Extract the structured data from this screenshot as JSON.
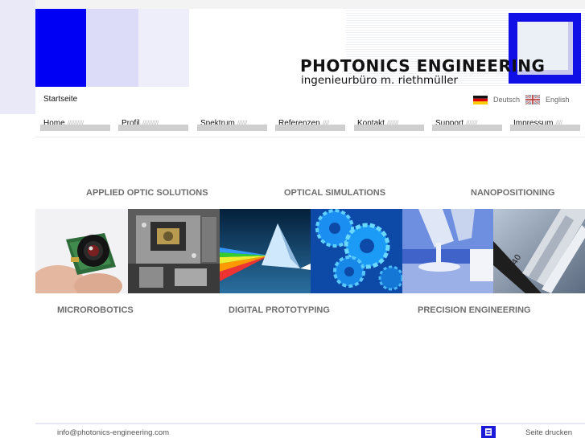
{
  "header": {
    "brand_title": "PHOTONICS ENGINEERING",
    "brand_subtitle": "ingenieurbüro m. riethmüller"
  },
  "breadcrumb": "Startseite",
  "languages": [
    {
      "label": "Deutsch",
      "flag": "de-flag-icon"
    },
    {
      "label": "English",
      "flag": "uk-flag-icon"
    }
  ],
  "nav": [
    {
      "label": "Home",
      "slashes": "//////////"
    },
    {
      "label": "Profil",
      "slashes": "//////////"
    },
    {
      "label": "Spektrum",
      "slashes": "//////"
    },
    {
      "label": "Referenzen",
      "slashes": "////"
    },
    {
      "label": "Kontakt",
      "slashes": "///////"
    },
    {
      "label": "Support",
      "slashes": "///////"
    },
    {
      "label": "Impressum",
      "slashes": "////"
    }
  ],
  "categories_top": [
    "APPLIED OPTIC SOLUTIONS",
    "OPTICAL SIMULATIONS",
    "NANOPOSITIONING"
  ],
  "categories_bottom": [
    "MICROROBOTICS",
    "DIGITAL PROTOTYPING",
    "PRECISION ENGINEERING"
  ],
  "colors": {
    "brand_blue": "#0000f5",
    "lavender": "#dcdcf8",
    "category_gray": "#6e6e6e"
  },
  "footer": {
    "email": "info@photonics-engineering.com",
    "print_label": "Seite drucken",
    "print_icon": "print-icon"
  }
}
